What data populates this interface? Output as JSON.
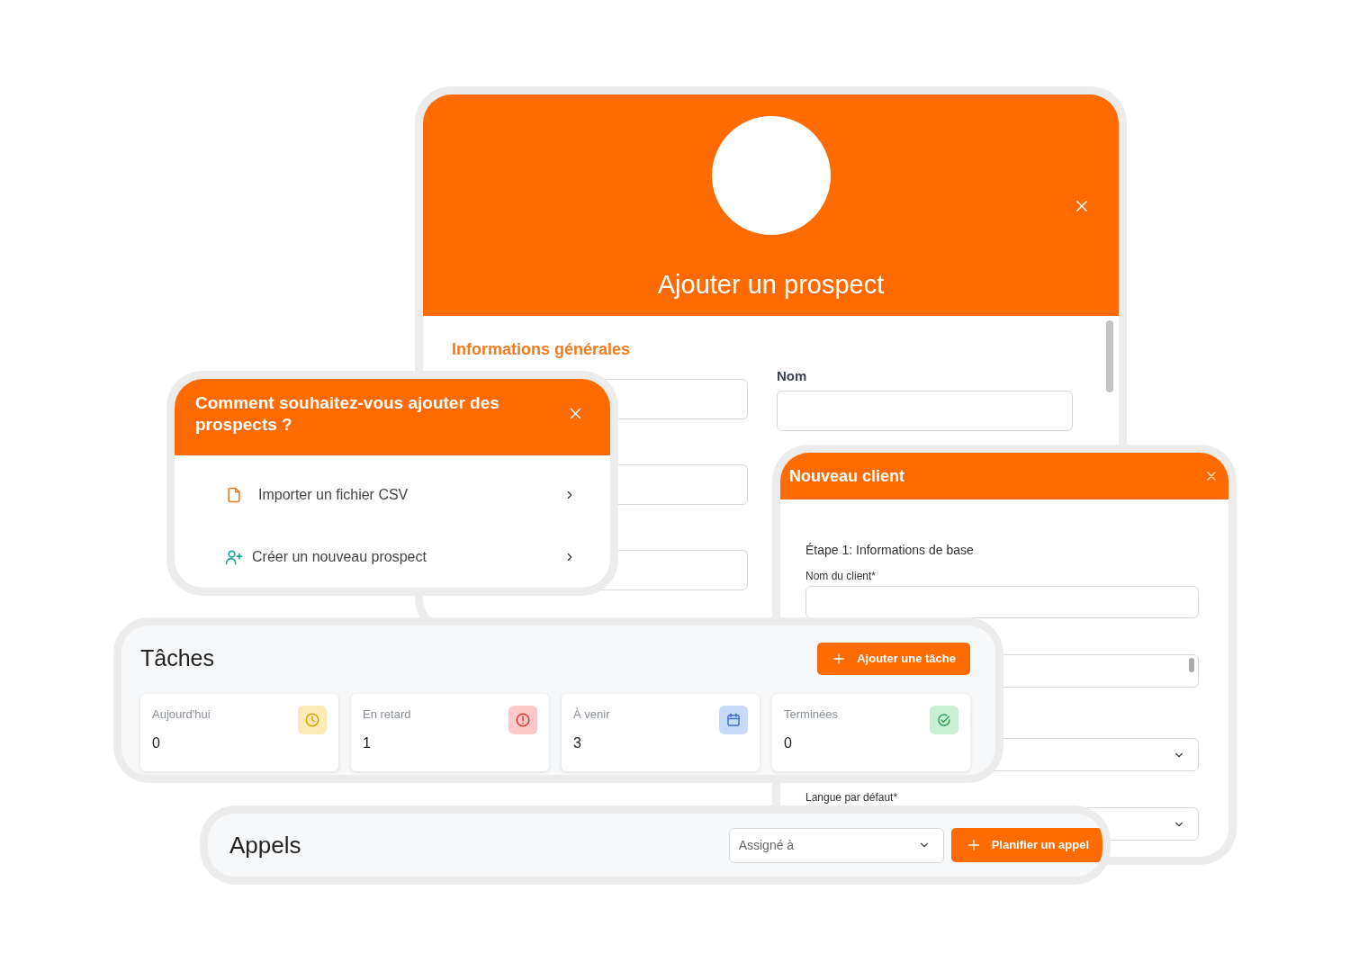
{
  "prospect_modal": {
    "title": "Ajouter un prospect",
    "section_title": "Informations générales",
    "name_field": {
      "label": "Nom"
    }
  },
  "add_prospects_popup": {
    "title": "Comment souhaitez-vous ajouter des prospects ?",
    "options": [
      {
        "label": "Importer un fichier CSV",
        "kind": "file"
      },
      {
        "label": "Créer un nouveau prospect",
        "kind": "user"
      }
    ]
  },
  "new_client_modal": {
    "title": "Nouveau client",
    "step": "Étape 1: Informations de base",
    "fields": [
      {
        "kind": "text",
        "label": "Nom du client*"
      },
      {
        "kind": "textarea"
      },
      {
        "kind": "select"
      },
      {
        "kind": "select",
        "label": "Langue par défaut*"
      }
    ]
  },
  "tasks": {
    "title": "Tâches",
    "add_button": "Ajouter une tâche",
    "stats": [
      {
        "label": "Aujourd'hui",
        "value": "0",
        "kind": "clock"
      },
      {
        "label": "En retard",
        "value": "1",
        "kind": "alert"
      },
      {
        "label": "À venir",
        "value": "3",
        "kind": "calendar"
      },
      {
        "label": "Terminées",
        "value": "0",
        "kind": "done"
      }
    ]
  },
  "calls": {
    "title": "Appels",
    "assignee_select": {
      "placeholder": "Assigné à"
    },
    "schedule_button": "Planifier un appel"
  }
}
